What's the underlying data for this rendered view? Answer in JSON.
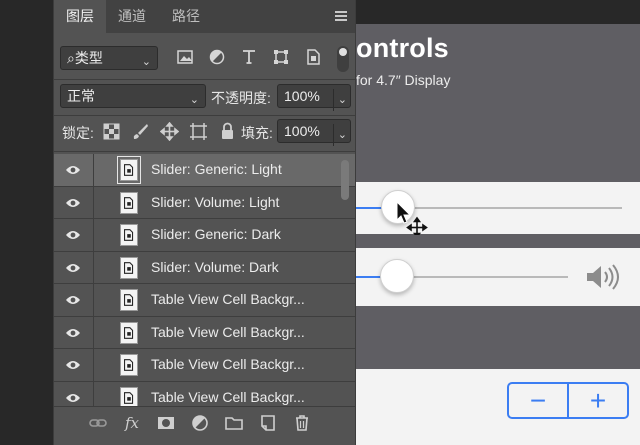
{
  "canvas": {
    "title": "ontrols",
    "subtitle": "for 4.7″ Display",
    "slider_1": {
      "value": 0.1
    },
    "slider_2": {
      "value": 0.2
    },
    "stepper": {
      "minus": "−",
      "plus": "+"
    }
  },
  "panel": {
    "tabs": [
      "图层",
      "通道",
      "路径"
    ],
    "active_tab": 0,
    "filter": {
      "label": "⌕类型"
    },
    "blend_mode": "正常",
    "opacity_label": "不透明度:",
    "opacity_value": "100%",
    "lock_label": "锁定:",
    "fill_label": "填充:",
    "fill_value": "100%",
    "layers": [
      {
        "name": "Slider: Generic: Light",
        "selected": true
      },
      {
        "name": "Slider: Volume: Light"
      },
      {
        "name": "Slider: Generic: Dark"
      },
      {
        "name": "Slider: Volume: Dark"
      },
      {
        "name": "Table View Cell Backgr..."
      },
      {
        "name": "Table View Cell Backgr..."
      },
      {
        "name": "Table View Cell Backgr..."
      },
      {
        "name": "Table View Cell Backgr..."
      }
    ],
    "footer_icons": [
      "link-icon",
      "fx-icon",
      "mask-icon",
      "adjustment-icon",
      "folder-icon",
      "new-layer-icon",
      "trash-icon"
    ]
  },
  "colors": {
    "accent": "#3b7df2",
    "panel_bg": "#535353",
    "canvas_bg": "#5f5e63"
  }
}
